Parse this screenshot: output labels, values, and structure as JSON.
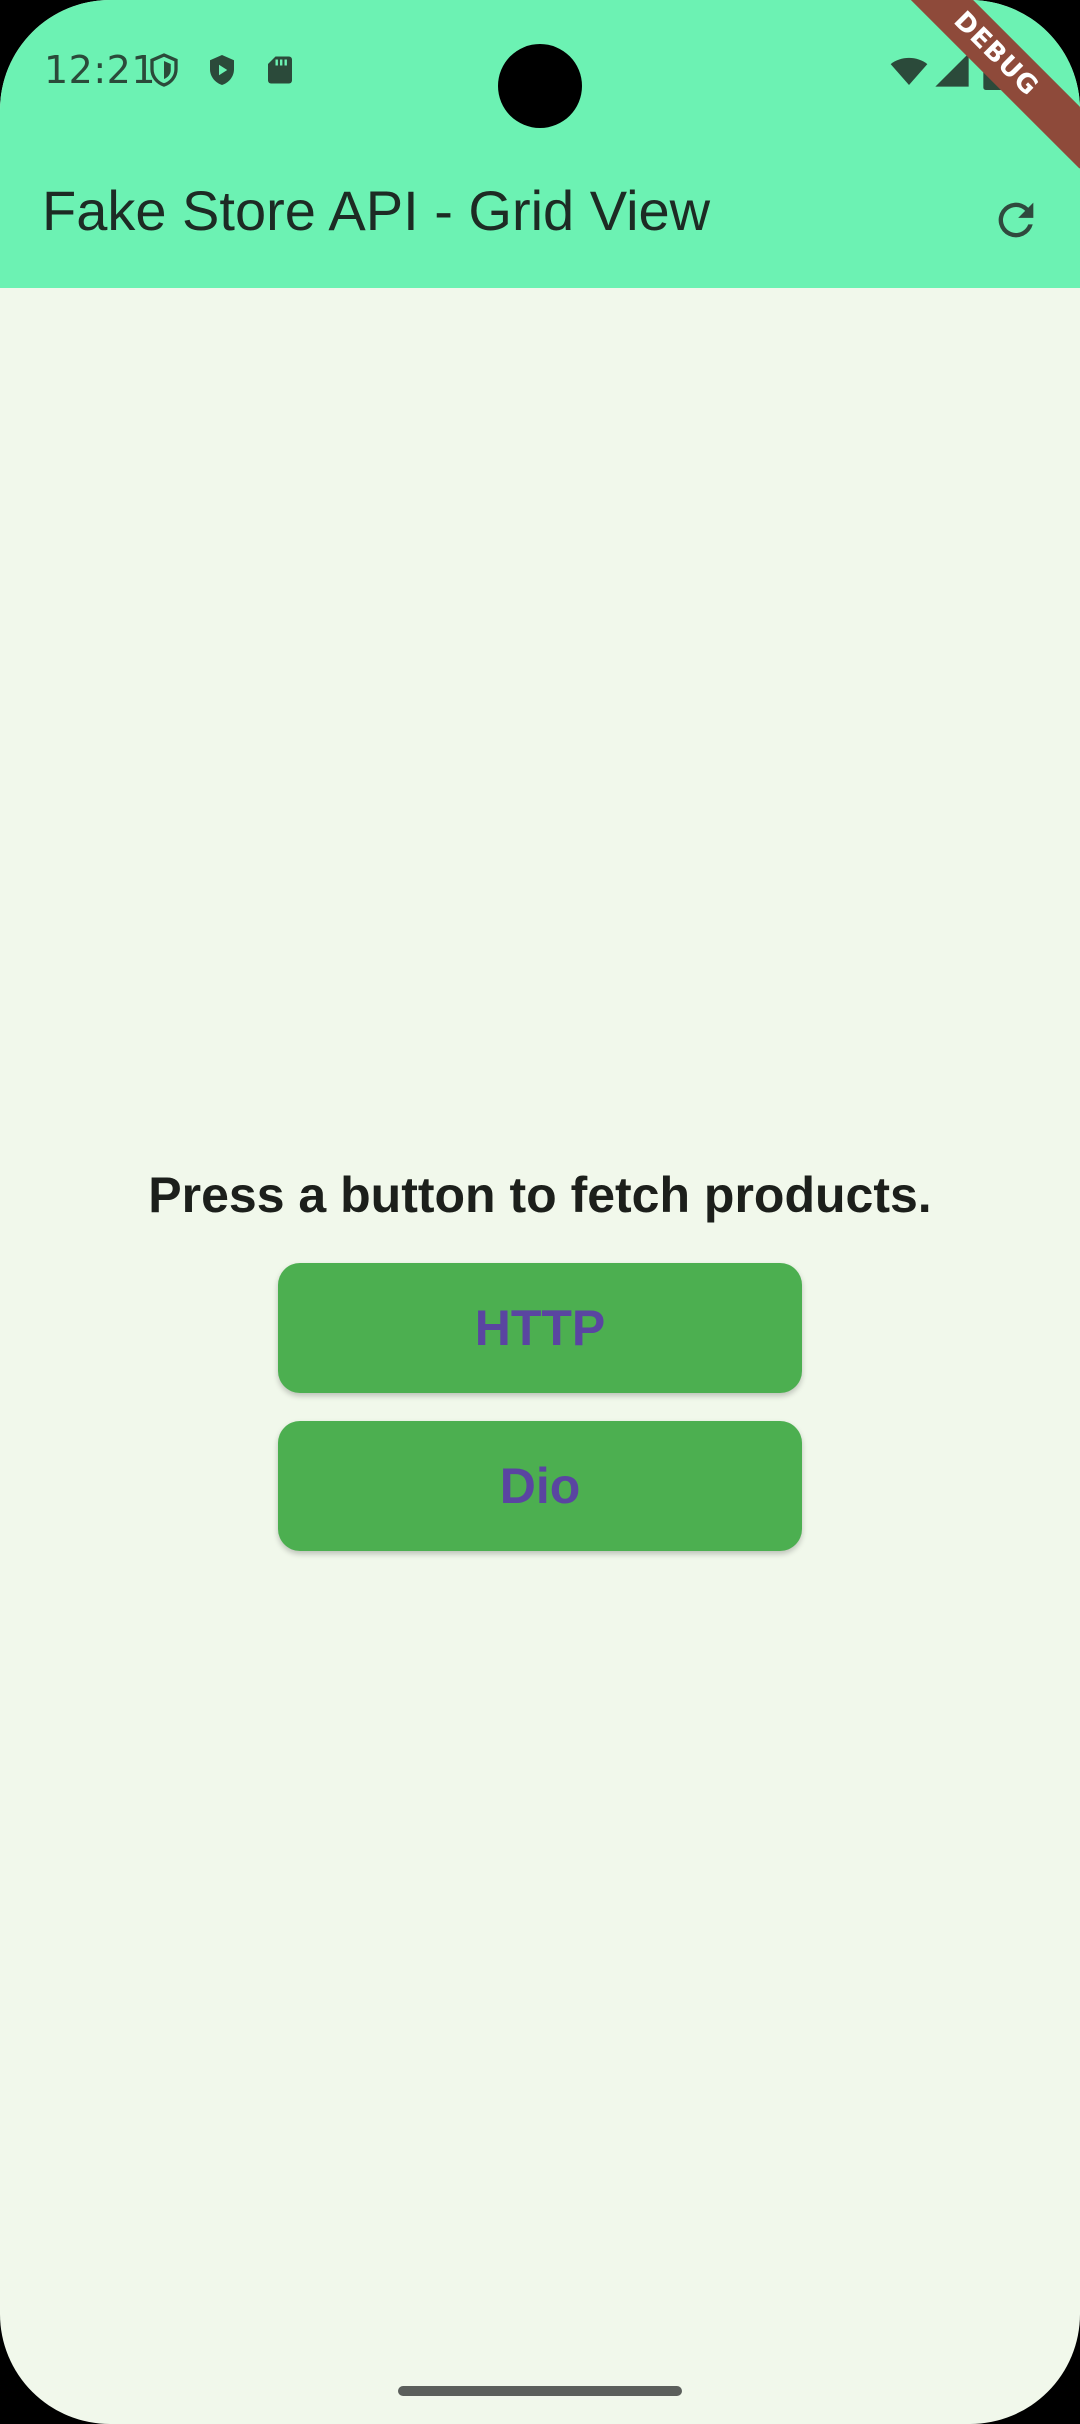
{
  "status_bar": {
    "time": "12:21",
    "left_icons": [
      "shield-outline-icon",
      "shield-play-icon",
      "sd-card-icon"
    ],
    "right_icons": [
      "wifi-icon",
      "cell-signal-icon",
      "battery-icon"
    ]
  },
  "debug_banner": {
    "label": "DEBUG"
  },
  "app_bar": {
    "title": "Fake Store API - Grid View",
    "action_icon": "refresh-icon"
  },
  "main": {
    "prompt": "Press a button to fetch products.",
    "buttons": [
      {
        "label": "HTTP"
      },
      {
        "label": "Dio"
      }
    ]
  },
  "colors": {
    "app_bar": "#6cf2b3",
    "background": "#f1f8eb",
    "button": "#4caf50",
    "button_text": "#5a45a1",
    "debug_ribbon": "#8e4a3a"
  }
}
